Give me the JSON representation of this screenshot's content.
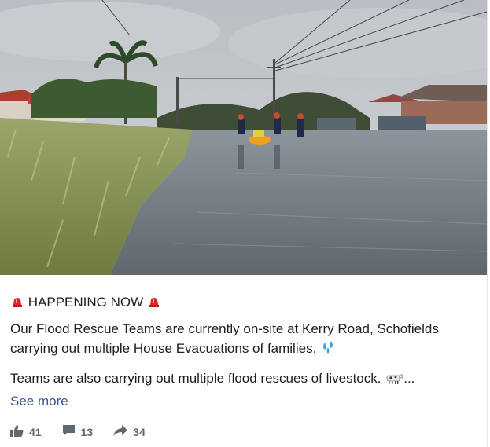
{
  "post": {
    "headline": "HAPPENING NOW",
    "paragraph1_line1": "Our Flood Rescue Teams are currently on-site at Kerry Road, Schofields",
    "paragraph1_line2": "carrying out multiple House Evacuations of families.",
    "paragraph2": "Teams are also carrying out multiple flood rescues of livestock.",
    "ellipsis": "...",
    "see_more": "See more",
    "icons": {
      "siren": "siren-icon",
      "droplets": "sweat-droplets-icon",
      "cow": "cow-icon"
    }
  },
  "actions": {
    "likes": "41",
    "comments": "13",
    "shares": "34"
  },
  "colors": {
    "text": "#1c1e21",
    "link": "#385898",
    "muted": "#606770",
    "siren_red": "#e02424",
    "droplet_blue": "#3ea6e8"
  }
}
